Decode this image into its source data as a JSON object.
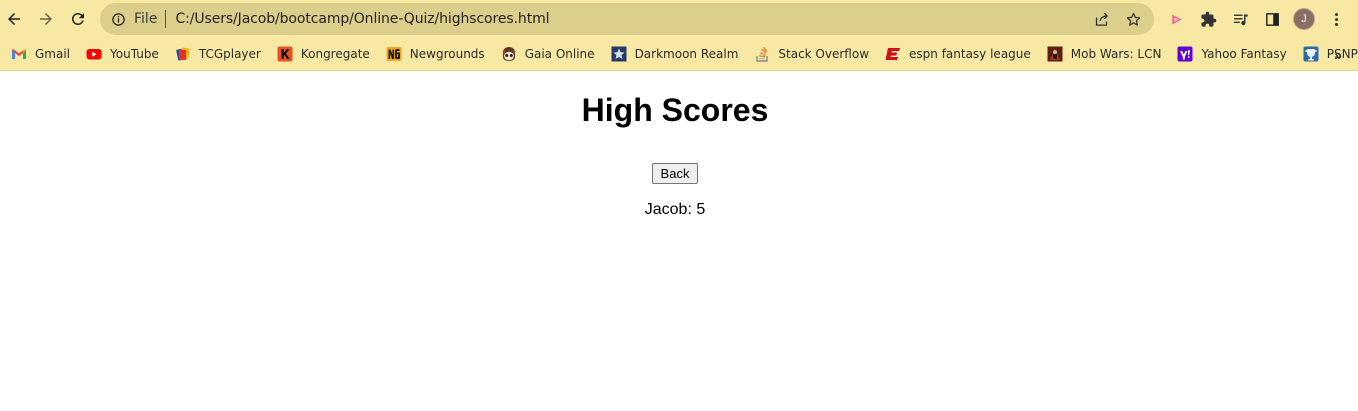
{
  "browser": {
    "omnibox": {
      "scheme_label": "File",
      "url": "C:/Users/Jacob/bootcamp/Online-Quiz/highscores.html"
    },
    "profile_initial": "J",
    "bookmarks": [
      {
        "label": "Gmail",
        "icon": "gmail-icon"
      },
      {
        "label": "YouTube",
        "icon": "youtube-icon"
      },
      {
        "label": "TCGplayer",
        "icon": "tcgplayer-icon"
      },
      {
        "label": "Kongregate",
        "icon": "kongregate-icon"
      },
      {
        "label": "Newgrounds",
        "icon": "newgrounds-icon"
      },
      {
        "label": "Gaia Online",
        "icon": "gaia-online-icon"
      },
      {
        "label": "Darkmoon Realm",
        "icon": "darkmoon-realm-icon"
      },
      {
        "label": "Stack Overflow",
        "icon": "stack-overflow-icon"
      },
      {
        "label": "espn fantasy league",
        "icon": "espn-icon"
      },
      {
        "label": "Mob Wars: LCN",
        "icon": "mob-wars-icon"
      },
      {
        "label": "Yahoo Fantasy",
        "icon": "yahoo-icon"
      },
      {
        "label": "PSNProfiles",
        "icon": "psnprofiles-icon"
      }
    ],
    "bookmarks_more": "»",
    "colors": {
      "chrome_bg": "#f7e8a4",
      "omnibox_bg": "#dccf8c"
    }
  },
  "page": {
    "title": "High Scores",
    "back_button_label": "Back",
    "scores": [
      "Jacob: 5"
    ]
  }
}
